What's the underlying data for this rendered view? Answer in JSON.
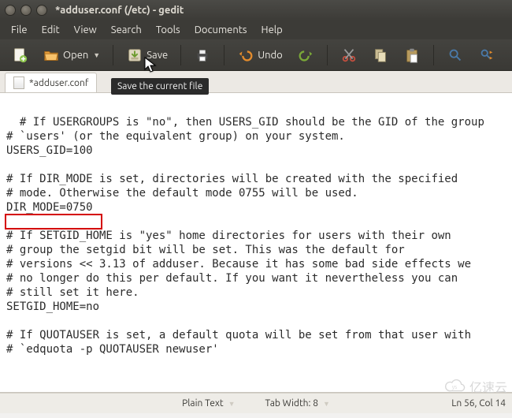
{
  "window": {
    "title": "*adduser.conf (/etc) - gedit"
  },
  "menubar": {
    "file": "File",
    "edit": "Edit",
    "view": "View",
    "search": "Search",
    "tools": "Tools",
    "documents": "Documents",
    "help": "Help"
  },
  "toolbar": {
    "open": "Open",
    "save": "Save",
    "undo": "Undo"
  },
  "tooltip": {
    "save": "Save the current file"
  },
  "tab": {
    "label": "*adduser.conf"
  },
  "editor": {
    "content": "# If USERGROUPS is \"no\", then USERS_GID should be the GID of the group\n# `users' (or the equivalent group) on your system.\nUSERS_GID=100\n\n# If DIR_MODE is set, directories will be created with the specified\n# mode. Otherwise the default mode 0755 will be used.\nDIR_MODE=0750\n\n# If SETGID_HOME is \"yes\" home directories for users with their own\n# group the setgid bit will be set. This was the default for\n# versions << 3.13 of adduser. Because it has some bad side effects we\n# no longer do this per default. If you want it nevertheless you can\n# still set it here.\nSETGID_HOME=no\n\n# If QUOTAUSER is set, a default quota will be set from that user with\n# `edquota -p QUOTAUSER newuser'"
  },
  "statusbar": {
    "lang": "Plain Text",
    "tabwidth": "Tab Width: 8",
    "position": "Ln 56, Col 14"
  },
  "watermark": "亿速云"
}
